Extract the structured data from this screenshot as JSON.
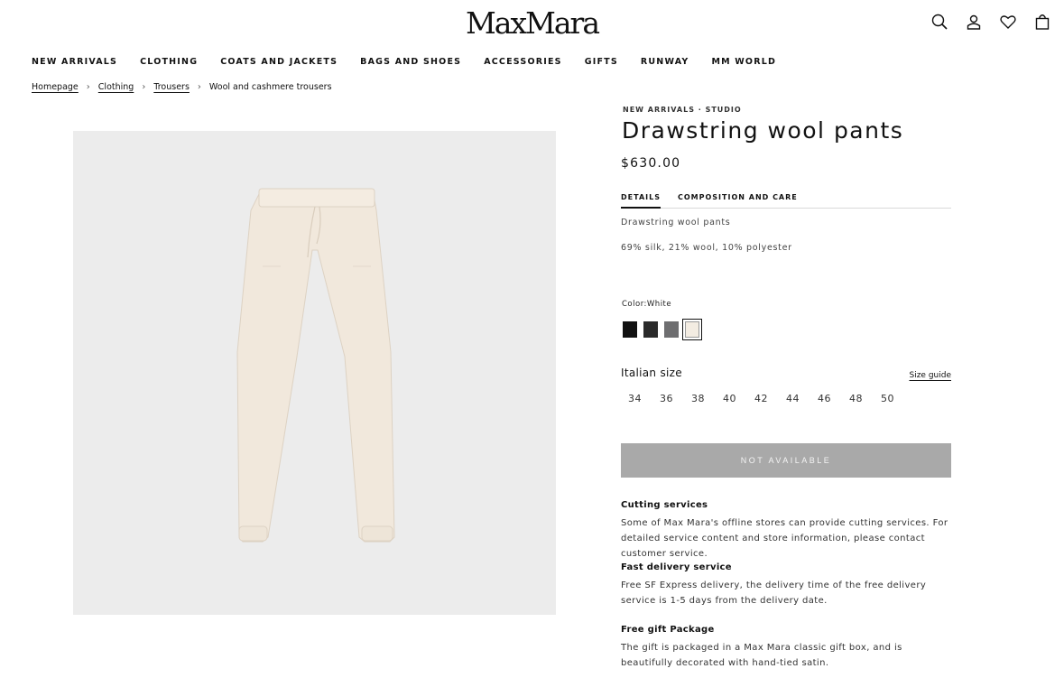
{
  "header": {
    "logo_text": "MaxMara",
    "icons": [
      "search-icon",
      "account-icon",
      "wishlist-heart-icon",
      "shopping-bag-icon"
    ]
  },
  "nav": {
    "items": [
      {
        "label": "NEW ARRIVALS"
      },
      {
        "label": "CLOTHING"
      },
      {
        "label": "COATS AND JACKETS"
      },
      {
        "label": "BAGS AND SHOES"
      },
      {
        "label": "ACCESSORIES"
      },
      {
        "label": "GIFTS"
      },
      {
        "label": "RUNWAY"
      },
      {
        "label": "MM WORLD"
      }
    ]
  },
  "breadcrumb": {
    "items": [
      {
        "label": "Homepage"
      },
      {
        "label": "Clothing"
      },
      {
        "label": "Trousers"
      },
      {
        "label": "Wool and cashmere trousers"
      }
    ],
    "separator": "›"
  },
  "product": {
    "eyebrow": "NEW ARRIVALS · STUDIO",
    "title": "Drawstring wool pants",
    "price": "$630.00",
    "tabs": [
      {
        "label": "DETAILS",
        "active": true
      },
      {
        "label": "COMPOSITION AND CARE",
        "active": false
      }
    ],
    "details": [
      "Drawstring wool pants",
      "69% silk, 21% wool, 10% polyester"
    ],
    "color_label": "Color:White",
    "swatches": [
      {
        "color": "#111111"
      },
      {
        "color": "#2a2a2a"
      },
      {
        "color": "#6e6e70"
      },
      {
        "color": "#f3ece2",
        "selected": true
      }
    ],
    "size_label": "Italian size",
    "size_guide": "Size guide",
    "sizes": [
      "34",
      "36",
      "38",
      "40",
      "42",
      "44",
      "46",
      "48",
      "50"
    ],
    "button_label": "NOT AVAILABLE"
  },
  "services": [
    {
      "heading": "Cutting services",
      "body": "Some of Max Mara's offline stores can provide cutting services. For detailed service content and store information, please contact customer service."
    },
    {
      "heading": "Fast delivery service",
      "body": "Free SF Express delivery, the delivery time of the free delivery service is 1-5 days from the delivery date."
    },
    {
      "heading": "Free gift Package",
      "body": "The gift is packaged in a Max Mara classic gift box, and is beautifully decorated with hand-tied satin."
    }
  ],
  "colors": {
    "photo_bg": "#ececec",
    "pants": "#f1e8dc",
    "button_bg": "#a9a9a9"
  }
}
